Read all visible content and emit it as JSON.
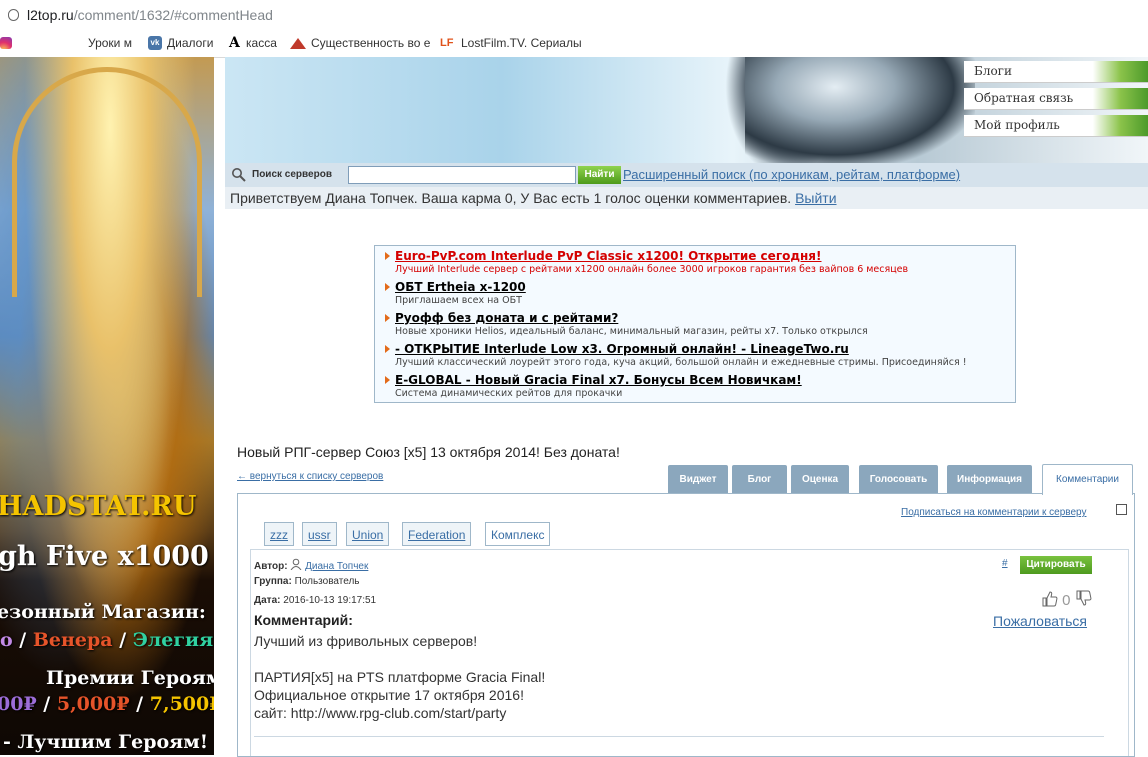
{
  "browser": {
    "url_host": "l2top.ru",
    "url_path": "/comment/1632/#commentHead",
    "bookmarks": [
      {
        "label": "Уроки м",
        "icon": "bookmark-icon"
      },
      {
        "label": "Диалоги",
        "icon": "vk-icon"
      },
      {
        "label": "касса",
        "icon": "a-letter-icon"
      },
      {
        "label": "Существенность во е",
        "icon": "mountain-icon"
      },
      {
        "label": "LostFilm.TV. Сериалы",
        "icon": "lf-icon"
      }
    ]
  },
  "left_ad": {
    "site": "HADSTAT.RU",
    "line1": "gh Five x1000",
    "line2": "езонный Магазин:",
    "line3a": "о",
    "line3b": "Венера",
    "line3c": "Элегия",
    "line4": "Премии Героям:",
    "line5a": "00₽",
    "line5b": "5,000₽",
    "line5c": "7,500₽",
    "line6": "- Лучшим Героям!"
  },
  "header_menu": [
    "Блоги",
    "Обратная связь",
    "Мой профиль"
  ],
  "search": {
    "label": "Поиск серверов",
    "button": "Найти",
    "advanced": "Расширенный поиск (по хроникам, рейтам, платформе)"
  },
  "greeting": {
    "text_before": "Приветствуем Диана Топчек. Ваша карма ",
    "karma": "0",
    "text_after": ", У Вас есть 1 голос оценки комментариев. ",
    "logout": "Выйти"
  },
  "ads": [
    {
      "title": "Euro-PvP.com Interlude PvP Classic x1200! Открытие сегодня!",
      "desc": "Лучший Interlude сервер с рейтами x1200 онлайн более 3000 игроков гарантия без вайпов 6 месяцев",
      "color": "#d40000"
    },
    {
      "title": "ОБТ Ertheia x-1200",
      "desc": "Приглашаем всех на ОБТ",
      "color": "#000000"
    },
    {
      "title": "Руофф без доната и с рейтами?",
      "desc": "Новые хроники Helios, идеальный баланс, минимальный магазин, рейты x7. Только открылся",
      "color": "#000000"
    },
    {
      "title": "- ОТКРЫТИЕ Interlude Low x3. Огромный онлайн! - LineageTwo.ru",
      "desc": "Лучший классический лоурейт этого года, куча акций, большой онлайн и ежедневные стримы. Присоединяйся !",
      "color": "#000000"
    },
    {
      "title": "E-GLOBAL - Новый Gracia Final x7. Бонусы Всем Новичкам!",
      "desc": "Система динамических рейтов для прокачки",
      "color": "#000000"
    }
  ],
  "server": {
    "title": "Новый РПГ-сервер Союз [x5] 13 октября 2014! Без доната!",
    "back_link": "← вернуться к списку серверов"
  },
  "tabs": [
    "Виджет",
    "Блог",
    "Оценка",
    "Голосовать",
    "Информация",
    "Комментарии"
  ],
  "subscribe": "Подписаться на комментарии к серверу",
  "tags": [
    "zzz",
    "ussr",
    "Union",
    "Federation",
    "Комплекс"
  ],
  "comment": {
    "author_label": "Автор:",
    "author": "Диана Топчек",
    "group_label": "Группа:",
    "group": "Пользователь",
    "date_label": "Дата:",
    "date": "2016-10-13 19:17:51",
    "quote_button": "Цитировать",
    "anchor": "#",
    "votes": "0",
    "complain": "Пожаловаться",
    "heading": "Комментарий:",
    "lines": [
      "Лучший из фривольных серверов!",
      "",
      "ПАРТИЯ[x5] на PTS платформе Gracia Final!",
      "Официальное открытие 17 октября 2016!",
      "сайт: http://www.rpg-club.com/start/party"
    ]
  }
}
